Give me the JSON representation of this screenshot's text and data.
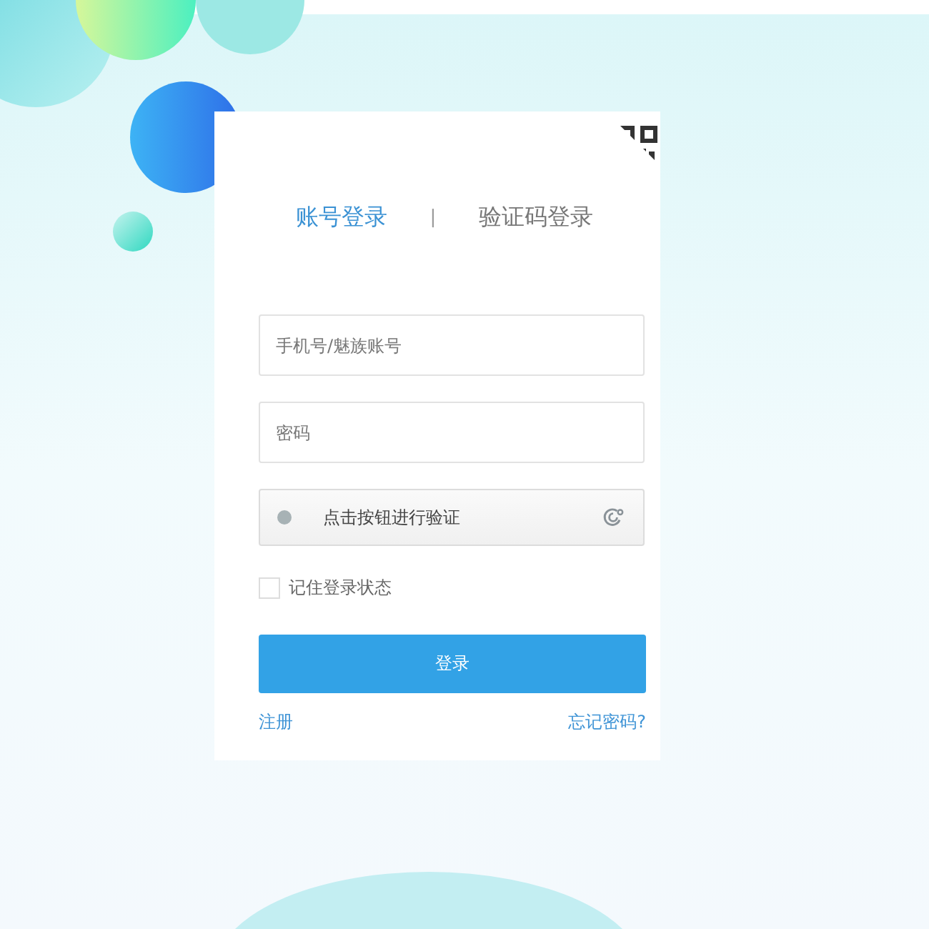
{
  "tabs": [
    {
      "label": "账号登录",
      "selected": true
    },
    {
      "label": "验证码登录",
      "selected": false
    }
  ],
  "tab_separator": "|",
  "account_field": {
    "placeholder": "手机号/魅族账号"
  },
  "password_field": {
    "placeholder": "密码"
  },
  "verify_button": {
    "label": "点击按钮进行验证"
  },
  "remember": {
    "label": "记住登录状态",
    "checked": false
  },
  "login_button": {
    "label": "登录"
  },
  "links": {
    "register": "注册",
    "forgot": "忘记密码?"
  }
}
